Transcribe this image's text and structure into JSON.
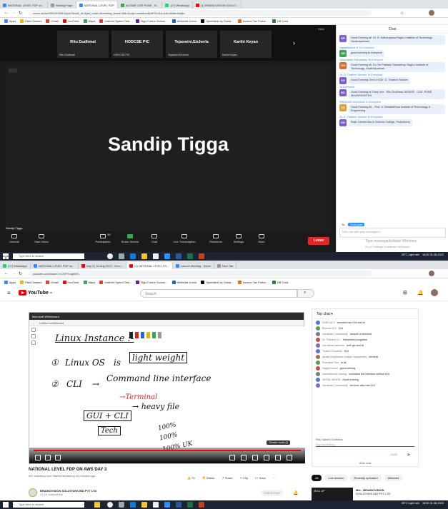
{
  "top_browser": {
    "tabs": [
      "NATIONAL LEVEL FDP on...",
      "Waiting Page",
      "NATIONAL LEVEL FDP",
      "AICSME CSE PUNE - N...",
      "(27) WhatsApp",
      "(1) BRAINOVISION SOLUT..."
    ],
    "url": "zoom.us/wc/99019030911/join?track_id=&jmf_code=&meeting_result=&tk=&cap=undefined&refTk=&s=&ts=f&fabubaijk=",
    "bookmarks": [
      "Apps",
      "Past Classes",
      "Gmail",
      "YouTube",
      "Maps",
      "Internet Speed Test...",
      "Byju Future School...",
      "Whitehat Junior",
      "Speedtest by Ookla...",
      "Income Tax Portal...",
      "DB Card"
    ]
  },
  "zoom": {
    "view_label": "View",
    "participants": [
      {
        "name": "Ritu Dudhmal",
        "sub": "Ritu Dudhmal"
      },
      {
        "name": "HODCSE PIC",
        "sub": "HODCSE PIC"
      },
      {
        "name": "Tejaswini,Etcherla",
        "sub": "Tejaswini,Etcherla"
      },
      {
        "name": "Karthi Keyan",
        "sub": "Karthi Keyan"
      }
    ],
    "next_arrow": "›",
    "active_speaker": "Sandip Tigga",
    "speaker_tag": "Sandip Tigga",
    "controls": [
      "Unmute",
      "Start Video",
      "Participants",
      "Share Screen",
      "Chat",
      "Live Transcription",
      "Reactions",
      "Settings",
      "More"
    ],
    "participant_count": "96",
    "leave_label": "Leave"
  },
  "zoom_chat": {
    "title": "Chat",
    "messages": [
      {
        "who": "",
        "initials": "DR",
        "color": "#7b5cd6",
        "text": "Good Evening all. Dr. G. Adinarayana Raghu Institute of Technology Visakhapatnam"
      },
      {
        "who": "Hasanthanna N To Everyone",
        "initials": "HN",
        "color": "#3aa655",
        "text": "good evening to everyone"
      },
      {
        "who": "Omprakash Samantray To Everyone",
        "initials": "OS",
        "color": "#e06b2e",
        "text": "Good Evening all. Dr Om Prakash Samantray, Raghu Institute of Technology, Visakhapatnam."
      },
      {
        "who": "Dr. D. Thatrich Selvam To Everyone",
        "initials": "DD",
        "color": "#7b5cd6",
        "text": "Good Evening One's HODr. D. Thatrich Selvam"
      },
      {
        "who": "To Everyone",
        "initials": "BD",
        "color": "#7b5cd6",
        "text": "Good Evening to Every one - Ritu Dudhmal, AISSMS - COE, PUNE, MAHARASHTRA"
      },
      {
        "who": "SRINIVAS DINGADA To Everyone",
        "initials": "SD",
        "color": "#e0a03a",
        "text": "Good Evening All... Prof. U SrinadhiEkan Institute of Technology & Engineering"
      },
      {
        "who": "Dr. D. Thatrich Selvam To Everyone",
        "initials": "DD",
        "color": "#7b5cd6",
        "text": "Rajiv Gandhi Arts & Science College, Puducherry"
      }
    ],
    "to_label": "To:",
    "to_value": "Everyone",
    "input_placeholder": "Who can see your messages?",
    "watermark_line1": "Type messageActivate Windows",
    "watermark_line2": "Go to Settings to activate Windows."
  },
  "taskbar_top": {
    "search_placeholder": "Type here to search",
    "weather": "25°C Light rain",
    "time": "18:59",
    "date": "31-08-2022"
  },
  "bottom_browser": {
    "tabs": [
      "(27) WhatsApp",
      "NATIONAL LEVEL FDP on...",
      "Day 3 | 24 Aug 2022 - Emo...",
      "(1) NATIONAL LEVEL FD...",
      "Launch Meeting - Zoom",
      "New Tab"
    ],
    "url": "youtube.com/watch?v=29P7oqyBH0",
    "bookmarks": [
      "Apps",
      "Past Classes",
      "Gmail",
      "YouTube",
      "Maps",
      "Internet Speed Test...",
      "Byju Future School...",
      "Whitehat Junior",
      "Speedtest by Ookla...",
      "Income Tax Portal...",
      "DB Card"
    ]
  },
  "youtube": {
    "logo_text": "YouTube",
    "logo_sup": "IN",
    "search_placeholder": "Search",
    "player_window_title": "Microsoft Whiteboard",
    "whiteboard_tab": "Untitled whiteboard",
    "whiteboard": {
      "title": "Linux Instance :-",
      "item1_num": "①",
      "item1_a": "Linux OS",
      "item1_b": "is",
      "item1_c": "light weight",
      "item2_num": "②",
      "item2_a": "CLI",
      "item2_arrow": "→",
      "item2_b": "Command line interface",
      "terminal": "→Terminal",
      "gui": "GUI + CLI",
      "heavy": "→ heavy file",
      "tech": "Tech",
      "n1": "100%",
      "n2": "100%",
      "n3": "100% UK"
    },
    "theater_label": "Theater mode (t)",
    "time": "",
    "chat": {
      "title": "Top chat",
      "messages": [
        {
          "user": "SAROJA S",
          "text": "windows has GUI and cli",
          "color": "#4a7cd6"
        },
        {
          "user": "Bhavani B K",
          "text": "GUI",
          "color": "#5a9a5a"
        },
        {
          "user": "Sandipan Chakravarty",
          "text": "console or terminal",
          "color": "#7a7a7a"
        },
        {
          "user": "Dr. Prakash S.L.",
          "text": "Interpreted programs",
          "color": "#c05050"
        },
        {
          "user": "Sarmilhad bahimda",
          "text": "both gui and cli",
          "color": "#8a6ac2"
        },
        {
          "user": "Thabet Sunnetha",
          "text": "GUI",
          "color": "#4a7cd6"
        },
        {
          "user": "jayalal polytechnic college marayamthy",
          "text": "terminal",
          "color": "#a07040"
        },
        {
          "user": "Sudhakar Rao",
          "text": "in all",
          "color": "#5a9a5a"
        },
        {
          "user": "Sagala Ismail",
          "text": "good evening",
          "color": "#c05050"
        },
        {
          "user": "manickkumar uchung",
          "text": "command line interface without GUI",
          "color": "#7a7a7a"
        },
        {
          "user": "SINTAL MEHTA",
          "text": "Good evening",
          "color": "#4a7cd6"
        },
        {
          "user": "Sandipan Chakravarty",
          "text": "but linux also has GUI",
          "color": "#8a6ac2"
        }
      ],
      "self_name": "Ritu Sakshi Dudhmal",
      "input_placeholder": "Say something...",
      "counter": "0/200",
      "hide_chat": "Hide chat"
    },
    "video_title": "NATIONAL LEVEL FDP ON AWS DAY 3",
    "video_sub": "851 watching now  Started streaming 25 minutes ago",
    "actions": [
      "79",
      "Dislike",
      "Share",
      "Clip",
      "Save"
    ],
    "channel_name": "BRAINOVISION SOLUTIONS IND PVT LTD",
    "channel_subs": "21.1K subscribers",
    "subscribe_label": "SUBSCRIBE",
    "chips": [
      "All",
      "Live session",
      "Recently uploaded",
      "Watched"
    ],
    "rec_thumb_text": "SKILL UP",
    "rec_title": "Mix - BRAINOVISION",
    "rec_channel": "SOLUTIONS IND PVT LTD"
  },
  "taskbar_bottom": {
    "search_placeholder": "Type here to search",
    "weather": "25°C Light rain",
    "time": "18:59",
    "date": "31-08-2022"
  }
}
